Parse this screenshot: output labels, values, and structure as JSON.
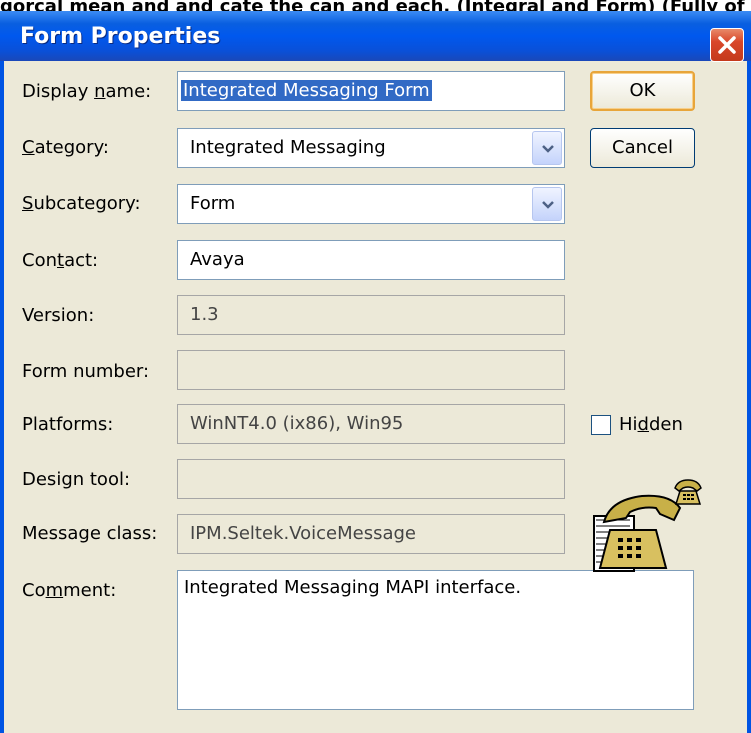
{
  "background_text": "gorcal mean and and cate the can and each. (Integral and Form) (Fully of (Fully of",
  "window": {
    "title": "Form Properties"
  },
  "labels": {
    "display_name_pre": "Display ",
    "display_name_u": "n",
    "display_name_post": "ame:",
    "category_u": "C",
    "category_post": "ategory:",
    "subcategory_u": "S",
    "subcategory_post": "ubcategory:",
    "contact_pre": "Con",
    "contact_u": "t",
    "contact_post": "act:",
    "version": "Version:",
    "form_number": "Form number:",
    "platforms": "Platforms:",
    "design_tool": "Design tool:",
    "message_class": "Message class:",
    "comment_pre": "Co",
    "comment_u": "m",
    "comment_post": "ment:"
  },
  "fields": {
    "display_name": "Integrated Messaging Form",
    "category": "Integrated Messaging",
    "subcategory": "Form",
    "contact": "Avaya",
    "version": "1.3",
    "form_number": "",
    "platforms": "WinNT4.0 (ix86), Win95",
    "design_tool": "",
    "message_class": "IPM.Seltek.VoiceMessage",
    "comment": "Integrated Messaging MAPI interface."
  },
  "buttons": {
    "ok": "OK",
    "cancel": "Cancel"
  },
  "hidden_checkbox": {
    "label_pre": "Hi",
    "label_u": "d",
    "label_post": "den",
    "checked": false
  },
  "icons": {
    "large": "telephone-large-icon",
    "small": "telephone-small-icon"
  }
}
